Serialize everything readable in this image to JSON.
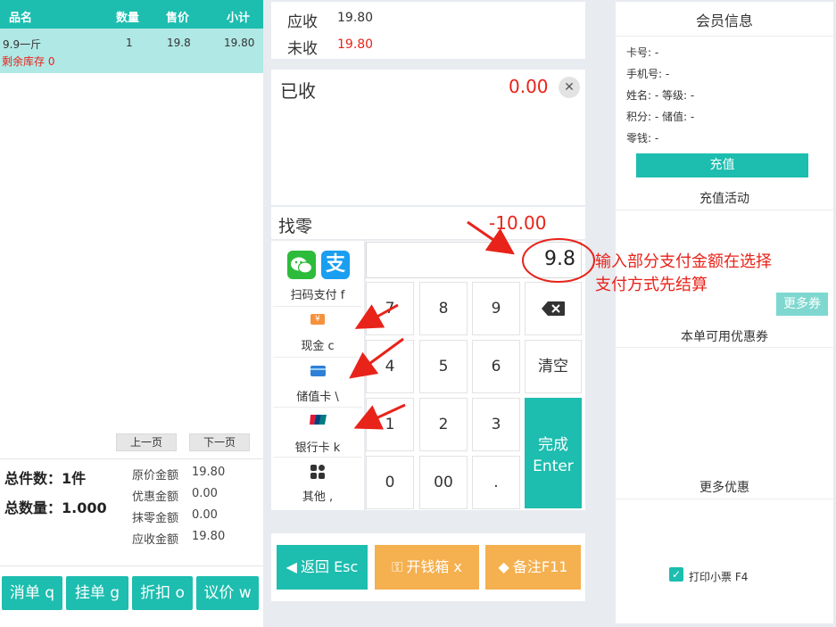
{
  "table": {
    "headers": [
      "品名",
      "数量",
      "售价",
      "小计"
    ],
    "rows": [
      {
        "name": "9.9一斤",
        "qty": "1",
        "price": "19.8",
        "subtotal": "19.80",
        "stock": "剩余库存 0"
      }
    ]
  },
  "pager": {
    "prev": "上一页",
    "next": "下一页"
  },
  "summary": {
    "total_items": "总件数：1件",
    "total_qty": "总数量：1.000",
    "original_label": "原价金额",
    "original_value": "19.80",
    "discount_label": "优惠金额",
    "discount_value": "0.00",
    "rounding_label": "抹零金额",
    "rounding_value": "0.00",
    "receivable_label": "应收金额",
    "receivable_value": "19.80"
  },
  "left_actions": [
    "消单 q",
    "挂单 g",
    "折扣 o",
    "议价 w"
  ],
  "amounts": {
    "receivable_label": "应收",
    "receivable_value": "19.80",
    "unpaid_label": "未收",
    "unpaid_value": "19.80",
    "paid_label": "已收",
    "paid_value": "0.00",
    "change_label": "找零",
    "change_value": "-10.00"
  },
  "input": {
    "value": "9.8"
  },
  "pay_methods": [
    {
      "label": "扫码支付 f",
      "icon": "wechat-alipay-icon"
    },
    {
      "label": "现金 c",
      "icon": "cash-icon"
    },
    {
      "label": "储值卡 \\",
      "icon": "stored-card-icon"
    },
    {
      "label": "银行卡 k",
      "icon": "unionpay-icon"
    },
    {
      "label": "其他 ,",
      "icon": "grid-icon"
    }
  ],
  "alipay_glyph": "支",
  "keypad": {
    "row1": [
      "7",
      "8",
      "9"
    ],
    "row2": [
      "4",
      "5",
      "6"
    ],
    "row3": [
      "1",
      "2",
      "3"
    ],
    "row4": [
      "0",
      "00",
      "."
    ],
    "clear": "清空",
    "done_line1": "完成",
    "done_line2": "Enter"
  },
  "annotation": {
    "line1": "输入部分支付金额在选择",
    "line2": "支付方式先结算",
    "color": "#e8231a"
  },
  "bottom_actions": {
    "back": "返回 Esc",
    "drawer": "开钱箱 x",
    "note": "备注F11"
  },
  "member": {
    "title": "会员信息",
    "card_no": "卡号: -",
    "phone": "手机号: -",
    "name_level": "姓名: -  等级: -",
    "points_balance": "积分: -  储值: -",
    "change": "零钱: -",
    "recharge": "充值",
    "recharge_activity": "充值活动",
    "more_coupons": "更多券",
    "available_coupons": "本单可用优惠券",
    "more_discounts": "更多优惠",
    "print_receipt": "打印小票 F4"
  },
  "colors": {
    "teal": "#1dbdaf",
    "orange": "#f5b04f",
    "red": "#e8231a",
    "row_bg": "#b0e8e5"
  }
}
